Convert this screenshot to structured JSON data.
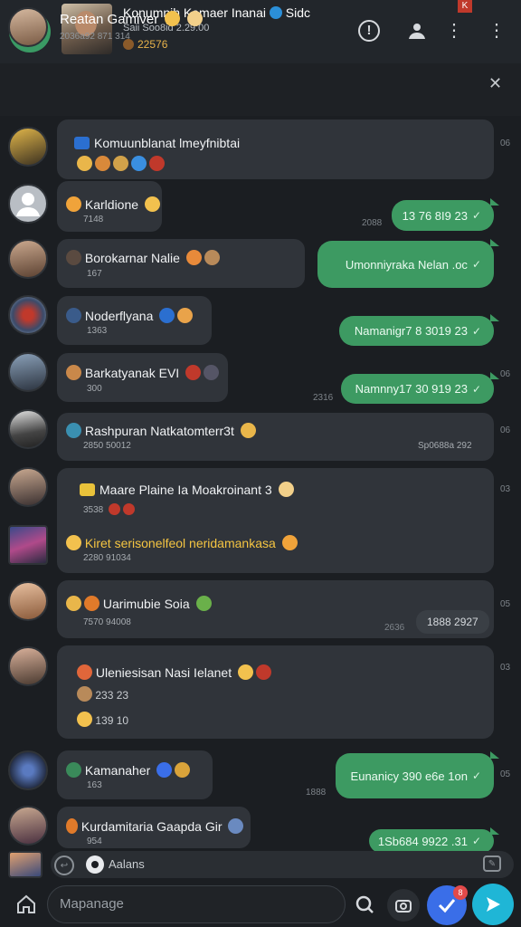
{
  "header": {
    "title": "Konumnih Kamaer Inanai",
    "title_suffix": "Sidc",
    "subtitle": "Saii Soo8id 2.29:00",
    "member_count": "22576",
    "badge": "K"
  },
  "pinned": {
    "title": "Reatan Gamiver",
    "subtitle": "2036a92 871 314"
  },
  "messages": [
    {
      "text": "Komuunblanat lmeyfnibtai",
      "side": "06"
    },
    {
      "text": "Karldione",
      "meta": "7148",
      "out_text": "13 76 8I9 23",
      "out_side": "2088"
    },
    {
      "text": "Borokarnar Nalie",
      "meta": "167",
      "out_text": "Umonniyraka Nelan .oc"
    },
    {
      "text": "Noderflyana",
      "meta": "1363",
      "out_text": "Namanigr7 8 3019 23"
    },
    {
      "text": "Barkatyanak EVI",
      "meta": "300",
      "out_text": "Namnny17 30 919 23",
      "out_side": "2316",
      "side": "06"
    },
    {
      "text": "Rashpuran Natkatomterr3t",
      "meta": "2850 50012",
      "meta_right": "Sp0688a 292",
      "side": "06"
    },
    {
      "text": "Maare Plaine Ia Moakroinant 3",
      "meta": "3538",
      "side": "03"
    },
    {
      "text": "Kiret serisonelfeol neridamankasa",
      "meta": "2280 91034"
    },
    {
      "text": "Uarimubie Soia",
      "meta": "7570 94008",
      "chip": "1888 2927",
      "chip_side": "2636",
      "side": "05"
    },
    {
      "text": "Uleniesisan Nasi Ielanet",
      "line2": "233 23",
      "line3": "139 10",
      "side": "03"
    },
    {
      "text": "Kamanaher",
      "meta": "163",
      "out_text": "Eunanicy 390 e6e 1on",
      "out_side": "1888",
      "side": "05"
    },
    {
      "text": "Kurdamitaria Gaapda Gir",
      "meta": "954",
      "out_text": "1Sb684 9922 .31"
    }
  ],
  "typing": {
    "label": "Aalans"
  },
  "composer": {
    "placeholder": "Mapanage"
  },
  "notification_badge": "8",
  "colors": {
    "outgoing": "#3d9a62",
    "incoming": "#30343a",
    "send": "#1fb6d6",
    "accent_blue": "#3a6ee8"
  }
}
